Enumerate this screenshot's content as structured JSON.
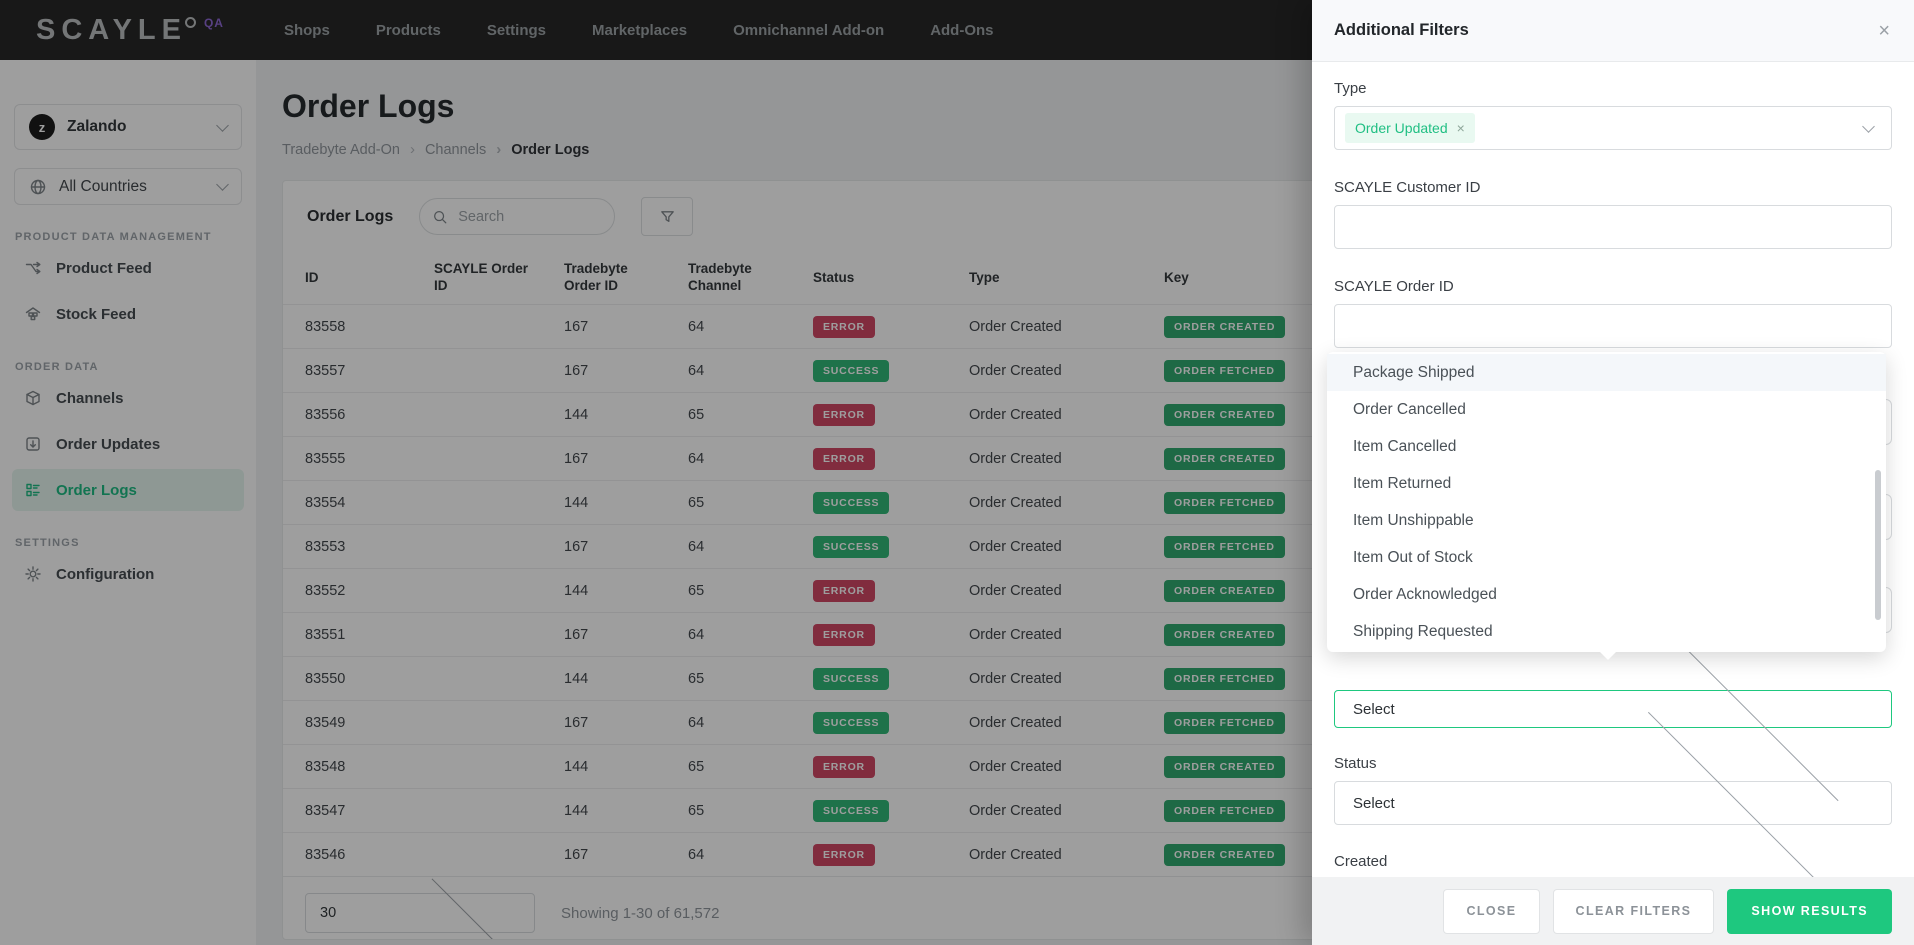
{
  "topbar": {
    "logo": "SCAYLE",
    "logo_badge": "QA",
    "nav": [
      {
        "label": "Shops"
      },
      {
        "label": "Products"
      },
      {
        "label": "Settings"
      },
      {
        "label": "Marketplaces"
      },
      {
        "label": "Omnichannel Add-on"
      },
      {
        "label": "Add-Ons"
      }
    ]
  },
  "sidebar": {
    "shop_selector": {
      "avatar_letter": "z",
      "label": "Zalando"
    },
    "country_selector": {
      "label": "All Countries"
    },
    "sections": [
      {
        "label": "PRODUCT DATA MANAGEMENT"
      },
      {
        "label": "ORDER DATA"
      },
      {
        "label": "SETTINGS"
      }
    ],
    "items": {
      "product_feed": "Product Feed",
      "stock_feed": "Stock Feed",
      "channels": "Channels",
      "order_updates": "Order Updates",
      "order_logs": "Order Logs",
      "configuration": "Configuration"
    }
  },
  "main": {
    "page_title": "Order Logs",
    "breadcrumb": [
      "Tradebyte Add-On",
      "Channels",
      "Order Logs"
    ],
    "card": {
      "title": "Order Logs",
      "search_placeholder": "Search",
      "table": {
        "columns": [
          "ID",
          "SCAYLE Order ID",
          "Tradebyte Order ID",
          "Tradebyte Channel",
          "Status",
          "Type",
          "Key"
        ],
        "rows": [
          {
            "id": "83558",
            "soid": "",
            "toid": "167",
            "tch": "64",
            "status": "ERROR",
            "type": "Order Created",
            "key": "ORDER CREATED"
          },
          {
            "id": "83557",
            "soid": "",
            "toid": "167",
            "tch": "64",
            "status": "SUCCESS",
            "type": "Order Created",
            "key": "ORDER FETCHED"
          },
          {
            "id": "83556",
            "soid": "",
            "toid": "144",
            "tch": "65",
            "status": "ERROR",
            "type": "Order Created",
            "key": "ORDER CREATED"
          },
          {
            "id": "83555",
            "soid": "",
            "toid": "167",
            "tch": "64",
            "status": "ERROR",
            "type": "Order Created",
            "key": "ORDER CREATED"
          },
          {
            "id": "83554",
            "soid": "",
            "toid": "144",
            "tch": "65",
            "status": "SUCCESS",
            "type": "Order Created",
            "key": "ORDER FETCHED"
          },
          {
            "id": "83553",
            "soid": "",
            "toid": "167",
            "tch": "64",
            "status": "SUCCESS",
            "type": "Order Created",
            "key": "ORDER FETCHED"
          },
          {
            "id": "83552",
            "soid": "",
            "toid": "144",
            "tch": "65",
            "status": "ERROR",
            "type": "Order Created",
            "key": "ORDER CREATED"
          },
          {
            "id": "83551",
            "soid": "",
            "toid": "167",
            "tch": "64",
            "status": "ERROR",
            "type": "Order Created",
            "key": "ORDER CREATED"
          },
          {
            "id": "83550",
            "soid": "",
            "toid": "144",
            "tch": "65",
            "status": "SUCCESS",
            "type": "Order Created",
            "key": "ORDER FETCHED"
          },
          {
            "id": "83549",
            "soid": "",
            "toid": "167",
            "tch": "64",
            "status": "SUCCESS",
            "type": "Order Created",
            "key": "ORDER FETCHED"
          },
          {
            "id": "83548",
            "soid": "",
            "toid": "144",
            "tch": "65",
            "status": "ERROR",
            "type": "Order Created",
            "key": "ORDER CREATED"
          },
          {
            "id": "83547",
            "soid": "",
            "toid": "144",
            "tch": "65",
            "status": "SUCCESS",
            "type": "Order Created",
            "key": "ORDER FETCHED"
          },
          {
            "id": "83546",
            "soid": "",
            "toid": "167",
            "tch": "64",
            "status": "ERROR",
            "type": "Order Created",
            "key": "ORDER CREATED"
          }
        ]
      },
      "pagination": {
        "page_size": "30",
        "summary": "Showing 1-30 of 61,572"
      }
    }
  },
  "filter_panel": {
    "title": "Additional Filters",
    "close_icon": "×",
    "fields": {
      "type_label": "Type",
      "type_tag": "Order Updated",
      "tag_remove": "×",
      "customer_id_label": "SCAYLE Customer ID",
      "customer_id_value": "",
      "order_id_label": "SCAYLE Order ID",
      "order_id_value": "",
      "open_select_value": "Select",
      "status_label": "Status",
      "status_value": "Select",
      "created_label": "Created"
    },
    "dropdown_options": [
      "Package Shipped",
      "Order Cancelled",
      "Item Cancelled",
      "Item Returned",
      "Item Unshippable",
      "Item Out of Stock",
      "Order Acknowledged",
      "Shipping Requested"
    ],
    "buttons": {
      "close": "CLOSE",
      "clear": "CLEAR FILTERS",
      "show": "SHOW RESULTS"
    }
  },
  "colors": {
    "accent": "#1ec87f",
    "error_badge": "#cf4160",
    "success_badge": "#2bb673",
    "key_badge": "#2aa76c",
    "qa_badge": "#8a63d2",
    "topbar_bg": "#212121"
  }
}
